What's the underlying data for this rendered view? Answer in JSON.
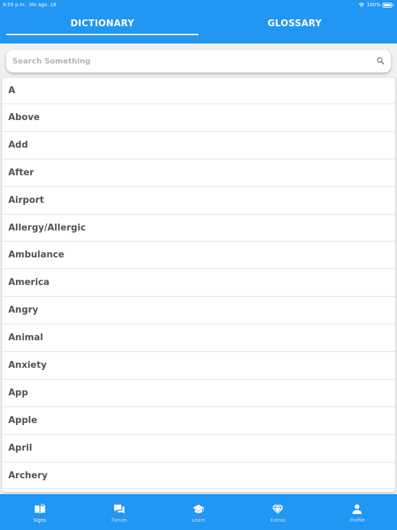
{
  "status_bar": {
    "time": "9:55 p.m.",
    "date": "Vie ago. 18",
    "battery": "100%"
  },
  "tabs": [
    {
      "label": "DICTIONARY",
      "active": true
    },
    {
      "label": "GLOSSARY",
      "active": false
    }
  ],
  "search": {
    "placeholder": "Search Something",
    "value": ""
  },
  "words": [
    "A",
    "Above",
    "Add",
    "After",
    "Airport",
    "Allergy/Allergic",
    "Ambulance",
    "America",
    "Angry",
    "Animal",
    "Anxiety",
    "App",
    "Apple",
    "April",
    "Archery"
  ],
  "bottom_nav": [
    {
      "label": "Signs",
      "icon": "book-icon",
      "active": true
    },
    {
      "label": "Forum",
      "icon": "chat-icon",
      "active": false
    },
    {
      "label": "Learn",
      "icon": "graduation-cap-icon",
      "active": false
    },
    {
      "label": "Extras",
      "icon": "diamond-icon",
      "active": false
    },
    {
      "label": "Profile",
      "icon": "person-icon",
      "active": false
    }
  ],
  "colors": {
    "primary": "#2196f3",
    "background": "#f0f0f0",
    "text": "#545454"
  }
}
